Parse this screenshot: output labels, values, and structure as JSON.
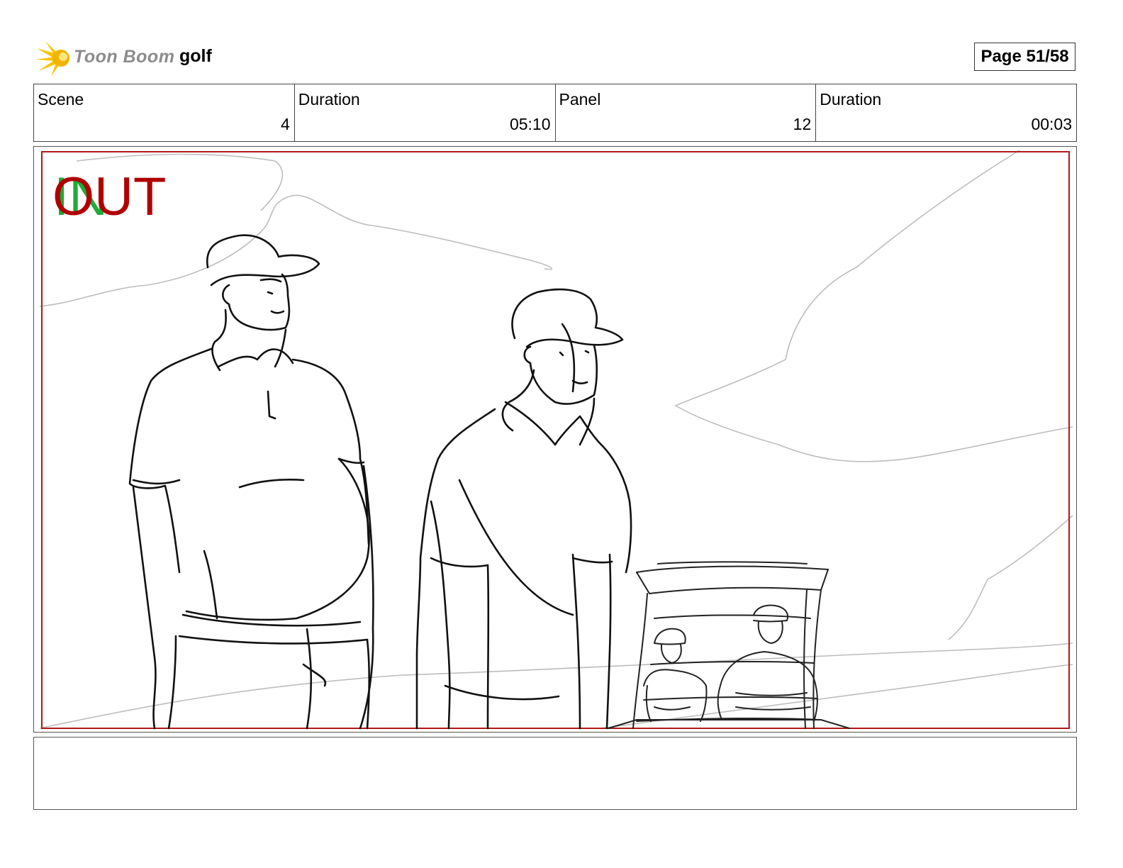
{
  "header": {
    "logo_text": "Toon Boom",
    "project_name": "golf",
    "page_label": "Page 51/58"
  },
  "info": {
    "scene_label": "Scene",
    "scene_value": "4",
    "scene_duration_label": "Duration",
    "scene_duration_value": "05:10",
    "panel_label": "Panel",
    "panel_value": "12",
    "panel_duration_label": "Duration",
    "panel_duration_value": "00:03"
  },
  "panel": {
    "in_marker": "IN",
    "out_marker": "OUT",
    "in_color": "#1faa3a",
    "out_color": "#b00000",
    "safe_frame_color": "#b01818"
  },
  "notes": {
    "text": ""
  }
}
